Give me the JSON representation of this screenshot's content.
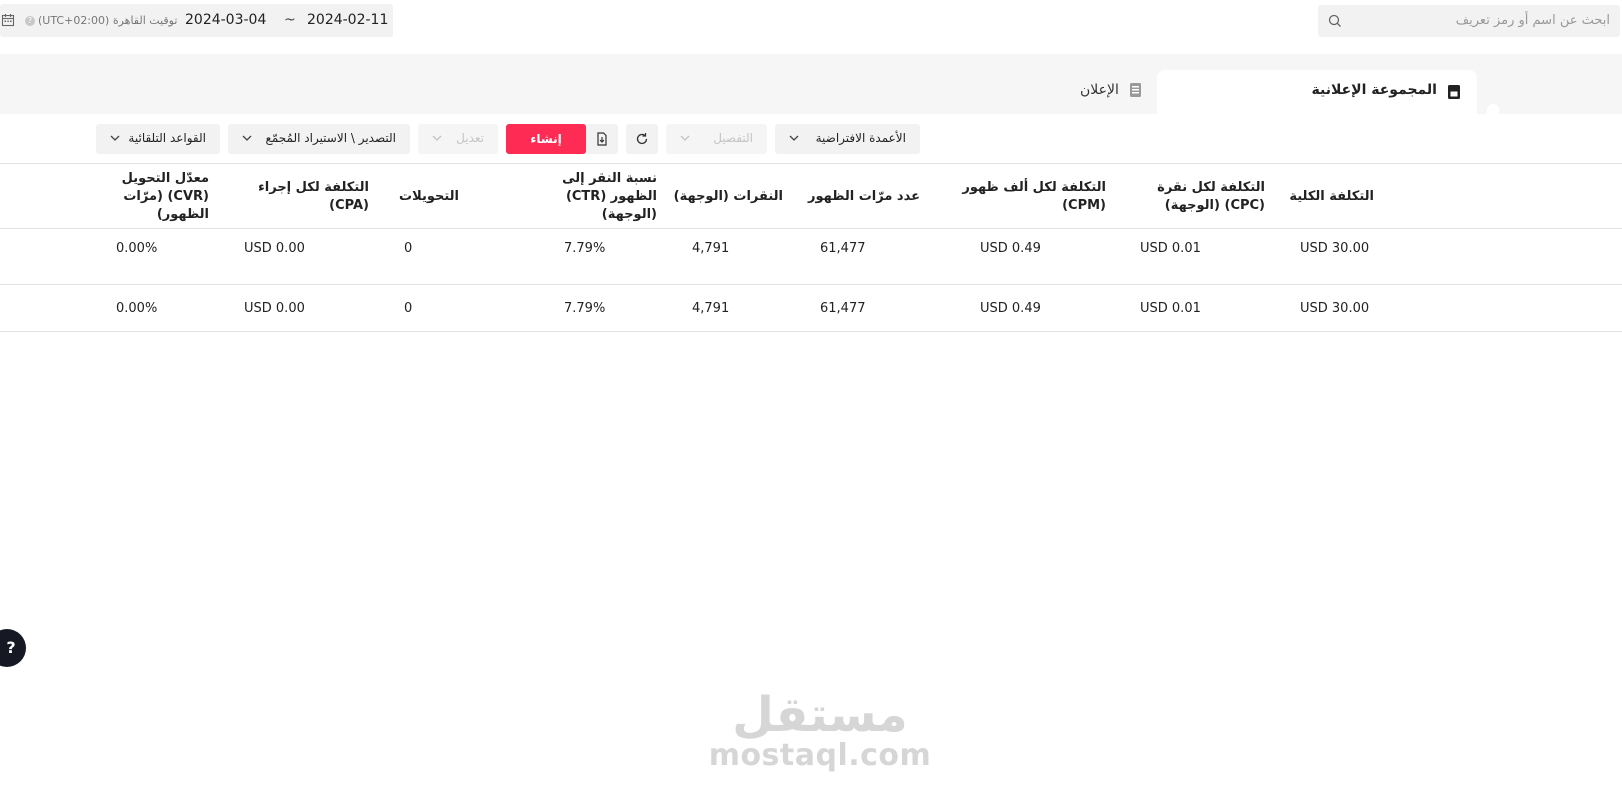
{
  "search": {
    "placeholder": "ابحث عن اسم أو رمز تعريف",
    "icon": "search-icon"
  },
  "date_range": {
    "timezone_label": "(UTC+02:00) توقيت القاهرة",
    "end_date": "2024-03-04",
    "separator": "~",
    "start_date": "2024-02-11"
  },
  "tabs": [
    {
      "label": "المجموعة الإعلانية",
      "icon": "ad-group-icon",
      "active": true
    },
    {
      "label": "الإعلان",
      "icon": "ad-icon",
      "active": false
    }
  ],
  "toolbar": {
    "default_columns": "الأعمدة الافتراضية",
    "breakdown": "التفصيل",
    "create": "إنشاء",
    "edit": "تعديل",
    "export_import": "التصدير \\ الاستيراد المُجمّع",
    "auto_rules": "القواعد التلقائية"
  },
  "table": {
    "headers": {
      "total_cost": "التكلفة الكلية",
      "cpc": "التكلفة لكل نقرة (CPC) (الوجهة)",
      "cpm": "التكلفة لكل ألف ظهور (CPM)",
      "impressions": "عدد مرّات الظهور",
      "clicks": "النقرات (الوجهة)",
      "ctr": "نسبة النقر إلى الظهور (CTR) (الوجهة)",
      "conversions": "التحويلات",
      "cpa": "التكلفة لكل إجراء (CPA)",
      "cvr": "معدّل التحويل (CVR) (مرّات الظهور)"
    },
    "rows": [
      {
        "total_cost": "USD 30.00",
        "cpc": "USD 0.01",
        "cpm": "USD 0.49",
        "impressions": "61,477",
        "clicks": "4,791",
        "ctr": "7.79%",
        "conversions": "0",
        "cpa": "USD 0.00",
        "cvr": "0.00%"
      },
      {
        "total_cost": "USD 30.00",
        "cpc": "USD 0.01",
        "cpm": "USD 0.49",
        "impressions": "61,477",
        "clicks": "4,791",
        "ctr": "7.79%",
        "conversions": "0",
        "cpa": "USD 0.00",
        "cvr": "0.00%"
      }
    ]
  },
  "help": {
    "label": "?"
  },
  "watermark": {
    "arabic": "مستقل",
    "latin": "mostaql.com"
  },
  "colors": {
    "primary": "#fe2c55",
    "help_bg": "#161823"
  }
}
